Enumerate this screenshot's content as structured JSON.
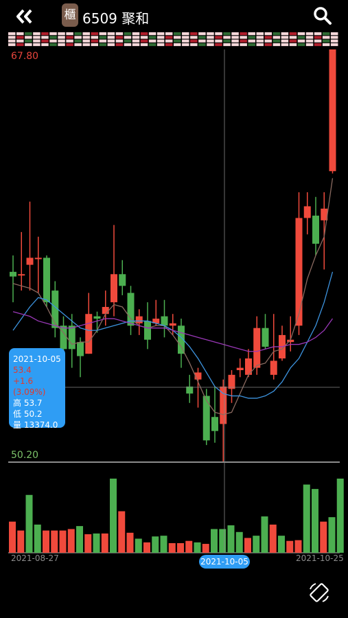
{
  "header": {
    "back_icon": "double-chevron-left-icon",
    "market_badge": "櫃",
    "stock_title": "6509 聚和",
    "search_icon": "search-icon"
  },
  "price_axis": {
    "max_label": "67.80",
    "min_label": "50.20"
  },
  "date_axis": {
    "start_label": "2021-08-27",
    "end_label": "2021-10-25",
    "selected_label": "2021-10-05"
  },
  "tooltip": {
    "date": "2021-10-05",
    "close": "53.4",
    "change": "+1.6 (3.09%)",
    "high": "高 53.7",
    "low": "低 50.2",
    "volume": "量 13374.0"
  },
  "colors": {
    "up": "#f04a3c",
    "down": "#4caf50",
    "ma5": "#8a6a60",
    "ma10": "#3d94e0",
    "ma20": "#9a38b8",
    "accent": "#2f9df4"
  },
  "footer": {
    "rotate_icon": "screen-rotate-icon"
  },
  "chart_data": {
    "type": "candlestick",
    "ylim": [
      50.2,
      67.8
    ],
    "candles": [
      {
        "o": 58.3,
        "c": 58.1,
        "h": 59.0,
        "l": 57.0
      },
      {
        "o": 58.2,
        "c": 58.2,
        "h": 60.0,
        "l": 57.5
      },
      {
        "o": 58.6,
        "c": 58.9,
        "h": 61.3,
        "l": 57.5
      },
      {
        "o": 58.9,
        "c": 58.9,
        "h": 59.8,
        "l": 57.4
      },
      {
        "o": 58.9,
        "c": 57.0,
        "h": 59.0,
        "l": 56.8
      },
      {
        "o": 57.5,
        "c": 55.9,
        "h": 57.9,
        "l": 55.5
      },
      {
        "o": 56.0,
        "c": 55.0,
        "h": 56.4,
        "l": 54.4
      },
      {
        "o": 56.0,
        "c": 55.0,
        "h": 56.5,
        "l": 54.2
      },
      {
        "o": 55.3,
        "c": 54.7,
        "h": 55.5,
        "l": 53.8
      },
      {
        "o": 54.8,
        "c": 56.5,
        "h": 57.4,
        "l": 54.8
      },
      {
        "o": 56.4,
        "c": 56.3,
        "h": 56.6,
        "l": 55.7
      },
      {
        "o": 56.5,
        "c": 56.8,
        "h": 57.5,
        "l": 56.0
      },
      {
        "o": 57.0,
        "c": 58.2,
        "h": 60.3,
        "l": 56.4
      },
      {
        "o": 58.2,
        "c": 57.7,
        "h": 58.8,
        "l": 57.3
      },
      {
        "o": 57.4,
        "c": 56.0,
        "h": 57.7,
        "l": 55.6
      },
      {
        "o": 56.1,
        "c": 56.4,
        "h": 56.7,
        "l": 55.6
      },
      {
        "o": 56.2,
        "c": 55.4,
        "h": 57.0,
        "l": 55.0
      },
      {
        "o": 56.1,
        "c": 56.3,
        "h": 57.1,
        "l": 56.0
      },
      {
        "o": 56.4,
        "c": 56.0,
        "h": 57.1,
        "l": 55.5
      },
      {
        "o": 56.0,
        "c": 56.1,
        "h": 56.5,
        "l": 55.6
      },
      {
        "o": 56.0,
        "c": 54.8,
        "h": 56.3,
        "l": 54.2
      },
      {
        "o": 53.4,
        "c": 53.1,
        "h": 53.9,
        "l": 52.7
      },
      {
        "o": 53.7,
        "c": 54.0,
        "h": 54.2,
        "l": 52.5
      },
      {
        "o": 53.0,
        "c": 51.1,
        "h": 53.3,
        "l": 50.9
      },
      {
        "o": 52.1,
        "c": 51.5,
        "h": 53.4,
        "l": 51.0
      },
      {
        "o": 51.8,
        "c": 53.4,
        "h": 53.7,
        "l": 50.2
      },
      {
        "o": 53.3,
        "c": 53.9,
        "h": 54.1,
        "l": 52.7
      },
      {
        "o": 54.1,
        "c": 54.2,
        "h": 54.6,
        "l": 53.8
      },
      {
        "o": 53.9,
        "c": 54.6,
        "h": 55.0,
        "l": 53.8
      },
      {
        "o": 54.2,
        "c": 55.9,
        "h": 56.4,
        "l": 53.9
      },
      {
        "o": 55.9,
        "c": 55.1,
        "h": 56.5,
        "l": 55.0
      },
      {
        "o": 53.9,
        "c": 54.5,
        "h": 56.5,
        "l": 53.7
      },
      {
        "o": 54.6,
        "c": 55.6,
        "h": 56.0,
        "l": 54.5
      },
      {
        "o": 55.3,
        "c": 55.4,
        "h": 56.4,
        "l": 54.9
      },
      {
        "o": 56.0,
        "c": 60.6,
        "h": 61.7,
        "l": 55.6
      },
      {
        "o": 60.6,
        "c": 61.1,
        "h": 61.7,
        "l": 59.9
      },
      {
        "o": 60.7,
        "c": 59.5,
        "h": 61.5,
        "l": 59.0
      },
      {
        "o": 60.5,
        "c": 61.0,
        "h": 61.7,
        "l": 58.4
      },
      {
        "o": 62.6,
        "c": 67.8,
        "h": 67.8,
        "l": 62.5
      }
    ],
    "volume": [
      {
        "v": 0.42,
        "up": true
      },
      {
        "v": 0.3,
        "up": true
      },
      {
        "v": 0.78,
        "up": false
      },
      {
        "v": 0.38,
        "up": false
      },
      {
        "v": 0.3,
        "up": true
      },
      {
        "v": 0.3,
        "up": true
      },
      {
        "v": 0.3,
        "up": true
      },
      {
        "v": 0.32,
        "up": true
      },
      {
        "v": 0.36,
        "up": false
      },
      {
        "v": 0.25,
        "up": true
      },
      {
        "v": 0.26,
        "up": false
      },
      {
        "v": 0.26,
        "up": true
      },
      {
        "v": 1.0,
        "up": false
      },
      {
        "v": 0.56,
        "up": true
      },
      {
        "v": 0.27,
        "up": true
      },
      {
        "v": 0.19,
        "up": false
      },
      {
        "v": 0.14,
        "up": true
      },
      {
        "v": 0.22,
        "up": false
      },
      {
        "v": 0.23,
        "up": false
      },
      {
        "v": 0.13,
        "up": true
      },
      {
        "v": 0.13,
        "up": true
      },
      {
        "v": 0.16,
        "up": true
      },
      {
        "v": 0.14,
        "up": false
      },
      {
        "v": 0.12,
        "up": true
      },
      {
        "v": 0.32,
        "up": false
      },
      {
        "v": 0.32,
        "up": false
      },
      {
        "v": 0.37,
        "up": false
      },
      {
        "v": 0.28,
        "up": false
      },
      {
        "v": 0.2,
        "up": true
      },
      {
        "v": 0.23,
        "up": false
      },
      {
        "v": 0.49,
        "up": false
      },
      {
        "v": 0.38,
        "up": true
      },
      {
        "v": 0.23,
        "up": false
      },
      {
        "v": 0.16,
        "up": true
      },
      {
        "v": 0.17,
        "up": true
      },
      {
        "v": 0.92,
        "up": false
      },
      {
        "v": 0.86,
        "up": false
      },
      {
        "v": 0.42,
        "up": true
      },
      {
        "v": 0.48,
        "up": false
      },
      {
        "v": 1.0,
        "up": false
      }
    ],
    "ma5": [
      57.8,
      57.7,
      57.6,
      57.4,
      56.8,
      56.1,
      55.7,
      55.2,
      55.3,
      55.3,
      55.8,
      56.5,
      56.9,
      56.8,
      56.3,
      56.0,
      55.9,
      56.0,
      56.0,
      55.6,
      55.1,
      54.4,
      53.6,
      52.8,
      52.3,
      52.2,
      52.3,
      53.1,
      53.9,
      54.3,
      54.4,
      54.9,
      55.0,
      55.4,
      56.5,
      58.0,
      59.0,
      59.8,
      62.3
    ],
    "ma10": [
      55.8,
      56.3,
      56.8,
      57.2,
      57.1,
      56.8,
      56.5,
      56.2,
      55.9,
      55.8,
      55.8,
      55.9,
      56.0,
      56.1,
      56.2,
      56.2,
      56.2,
      56.1,
      56.0,
      55.8,
      55.5,
      55.1,
      54.6,
      54.0,
      53.4,
      53.1,
      53.0,
      53.0,
      52.9,
      52.9,
      53.0,
      53.2,
      53.6,
      54.2,
      54.6,
      55.3,
      56.0,
      57.0,
      58.3
    ],
    "ma20": [
      56.6,
      56.5,
      56.4,
      56.2,
      56.1,
      56.0,
      55.9,
      55.9,
      56.0,
      56.1,
      56.2,
      56.3,
      56.3,
      56.2,
      56.1,
      56.0,
      55.9,
      55.9,
      55.9,
      55.8,
      55.7,
      55.6,
      55.5,
      55.4,
      55.3,
      55.2,
      55.1,
      55.0,
      54.9,
      54.9,
      55.0,
      55.1,
      55.1,
      55.2,
      55.2,
      55.3,
      55.5,
      55.8,
      56.3
    ]
  }
}
